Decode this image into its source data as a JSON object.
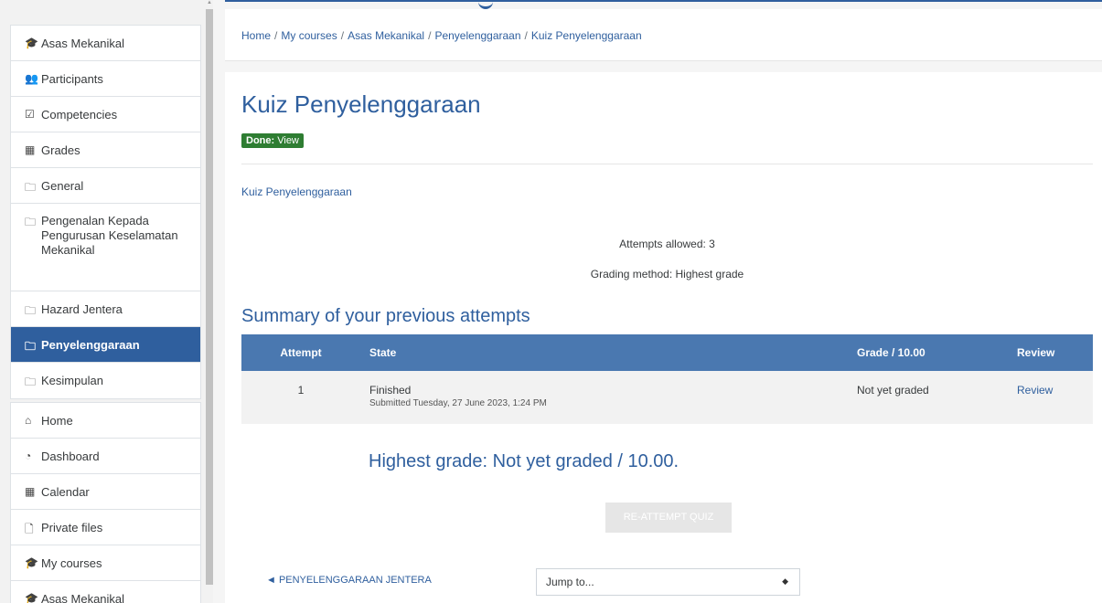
{
  "sidebar": {
    "course_items": [
      {
        "icon": "graduation-cap-icon",
        "glyph": "🎓",
        "label": "Asas Mekanikal"
      },
      {
        "icon": "users-icon",
        "glyph": "👥",
        "label": "Participants"
      },
      {
        "icon": "check-square-icon",
        "glyph": "☑",
        "label": "Competencies"
      },
      {
        "icon": "table-icon",
        "glyph": "▦",
        "label": "Grades"
      },
      {
        "icon": "folder-icon",
        "glyph": "🗀",
        "label": "General"
      },
      {
        "icon": "folder-icon",
        "glyph": "🗀",
        "label": "Pengenalan Kepada Pengurusan Keselamatan Mekanikal"
      },
      {
        "icon": "folder-icon",
        "glyph": "🗀",
        "label": "Hazard Jentera"
      },
      {
        "icon": "folder-icon",
        "glyph": "🗀",
        "label": "Penyelenggaraan",
        "active": true
      },
      {
        "icon": "folder-icon",
        "glyph": "🗀",
        "label": "Kesimpulan"
      }
    ],
    "site_items": [
      {
        "icon": "home-icon",
        "glyph": "⌂",
        "label": "Home"
      },
      {
        "icon": "dashboard-icon",
        "glyph": "◔",
        "label": "Dashboard"
      },
      {
        "icon": "calendar-icon",
        "glyph": "▦",
        "label": "Calendar"
      },
      {
        "icon": "file-icon",
        "glyph": "🗋",
        "label": "Private files"
      },
      {
        "icon": "graduation-cap-icon",
        "glyph": "🎓",
        "label": "My courses"
      },
      {
        "icon": "graduation-cap-icon",
        "glyph": "🎓",
        "label": "Asas Mekanikal"
      }
    ]
  },
  "breadcrumb": [
    "Home",
    "My courses",
    "Asas Mekanikal",
    "Penyelenggaraan",
    "Kuiz Penyelenggaraan"
  ],
  "page": {
    "title": "Kuiz Penyelenggaraan",
    "done_label": "Done:",
    "done_value": "View",
    "intro": "Kuiz Penyelenggaraan",
    "attempts_allowed": "Attempts allowed: 3",
    "grading_method": "Grading method: Highest grade",
    "summary_title": "Summary of your previous attempts",
    "highest_grade": "Highest grade: Not yet graded / 10.00.",
    "reattempt_label": "RE-ATTEMPT QUIZ",
    "prev_activity": "◄ PENYELENGGARAAN JENTERA",
    "jump_placeholder": "Jump to..."
  },
  "table": {
    "headers": [
      "Attempt",
      "State",
      "Grade / 10.00",
      "Review"
    ],
    "rows": [
      {
        "attempt": "1",
        "state": "Finished",
        "submitted": "Submitted Tuesday, 27 June 2023, 1:24 PM",
        "grade": "Not yet graded",
        "review": "Review"
      }
    ]
  },
  "colors": {
    "brand": "#2f5f9e",
    "table_header": "#4a78b0",
    "done_badge": "#2e7d32"
  }
}
